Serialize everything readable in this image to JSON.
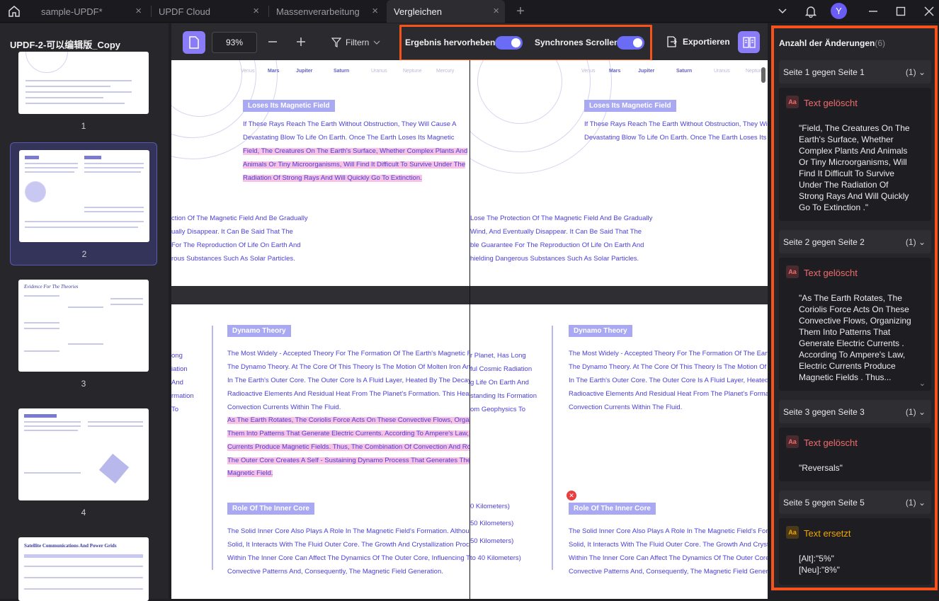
{
  "tabs": [
    {
      "label": "sample-UPDF*"
    },
    {
      "label": "UPDF Cloud"
    },
    {
      "label": "Massenverarbeitung"
    },
    {
      "label": "Vergleichen"
    }
  ],
  "window": {
    "avatar_letter": "Y",
    "close_glyph": "×",
    "add_tab_glyph": "+"
  },
  "sidebar": {
    "file_title": "UPDF-2-可以编辑版_Copy",
    "pages": [
      "1",
      "2",
      "3",
      "4"
    ],
    "thumb3_title": "Evidence For The Theories",
    "thumb5_title": "Satellite Communications And Power Grids"
  },
  "toolbar": {
    "zoom": "93%",
    "filter_label": "Filtern",
    "highlight_label": "Ergebnis hervorheben",
    "highlight_on": true,
    "sync_scroll_label": "Synchrones Scrollen",
    "sync_scroll_on": true,
    "export_label": "Exportieren"
  },
  "document": {
    "planets": [
      "Venus",
      "Mars",
      "Jupiter",
      "Saturn",
      "Uranus",
      "Neptune",
      "Mercury"
    ],
    "top": {
      "heading": "Loses Its Magnetic Field",
      "lines": [
        "If These Rays Reach The Earth Without Obstruction, They Will Cause A",
        "Devastating Blow To Life On Earth. Once The Earth Loses Its Magnetic",
        "Field, The Creatures On The Earth's Surface, Whether Complex Plants And",
        "Animals Or Tiny Microorganisms, Will Find It Difficult To Survive Under The",
        "Radiation Of Strong Rays And Will Quickly Go To Extinction."
      ],
      "left_lower": [
        "ction Of The Magnetic Field And Be Gradually",
        "ually Disappear. It Can Be Said That The",
        "For The Reproduction Of Life On Earth And",
        "rous Substances Such As Solar Particles."
      ],
      "right_lower": [
        "Lose The Protection Of The Magnetic Field And Be Gradually",
        "Wind, And Eventually Disappear. It Can Be Said That The",
        "ble Guarantee For The Reproduction Of Life On Earth And",
        "hielding Dangerous Substances Such As Solar Particles."
      ]
    },
    "bottom": {
      "dynamo_heading": "Dynamo Theory",
      "dynamo_lines": [
        "The Most Widely - Accepted Theory For The Formation Of The Earth's Magnetic Field Is",
        "The Dynamo Theory. At The Core Of This Theory Is The Motion Of Molten Iron And Nickel",
        "In The Earth's Outer Core. The Outer Core Is A Fluid Layer, Heated By The Decay Of",
        "Radioactive Elements And Residual Heat From The Planet's Formation. This Heat Creates",
        "Convection Currents Within The Fluid."
      ],
      "dynamo_highlight": [
        "As The Earth Rotates, The Coriolis Force Acts On These Convective Flows, Organizing",
        "Them Into Patterns That Generate Electric Currents. According To Ampere's Law, Electric",
        "Currents Produce Magnetic Fields. Thus, The Combination Of Convection And Rotation In",
        "The Outer Core Creates A Self - Sustaining Dynamo Process That Generates The Earth's",
        "Magnetic Field."
      ],
      "left_margin": [
        "ong",
        "iation",
        "And",
        "rmation",
        "To"
      ],
      "right_margin": [
        "r Planet, Has Long",
        "ful Cosmic Radiation",
        "g Life On Earth And",
        "standing Its Formation",
        "om Geophysics To"
      ],
      "km_lines": [
        "0 Kilometers)",
        "50 Kilometers)",
        "50 Kilometers)",
        "to 40 Kilometers)"
      ],
      "inner_heading": "Role Of The Inner Core",
      "inner_lines": [
        "The Solid Inner Core Also Plays A Role In The Magnetic Field's Formation. Although It Is",
        "Solid, It Interacts With The Fluid Outer Core. The Growth And Crystallization Processes",
        "Within The Inner Core Can Affect The Dynamics Of The Outer Core, Influencing The",
        "Convective Patterns And, Consequently, The Magnetic Field Generation."
      ]
    }
  },
  "changes": {
    "title": "Anzahl der Änderungen",
    "count": "(6)",
    "groups": [
      {
        "label": "Seite 1 gegen Seite 1",
        "count": "(1)",
        "type": "Text gelöscht",
        "type_color": "#f26b6b",
        "body": "\"Field, The Creatures On The Earth's Surface, Whether Complex Plants And Animals Or Tiny Microorganisms, Will Find It Difficult To Survive Under The Radiation Of Strong Rays And Will Quickly Go To Extinction .\""
      },
      {
        "label": "Seite 2 gegen Seite 2",
        "count": "(1)",
        "type": "Text gelöscht",
        "type_color": "#f26b6b",
        "body": "\"As The Earth Rotates, The Coriolis Force Acts On These Convective Flows, Organizing Them Into Patterns That Generate Electric Currents . According To Ampere's Law, Electric Currents Produce Magnetic Fields . Thus..."
      },
      {
        "label": "Seite 3 gegen Seite 3",
        "count": "(1)",
        "type": "Text gelöscht",
        "type_color": "#f26b6b",
        "body": "\"Reversals\""
      },
      {
        "label": "Seite 5 gegen Seite 5",
        "count": "(1)",
        "type": "Text ersetzt",
        "type_color": "#f0a500",
        "body": "[Alt]:\"5%\"\n[Neu]:\"8%\""
      }
    ]
  },
  "colors": {
    "accent": "#6a6cf6",
    "highlight_border": "#f5521c",
    "deleted": "#f26b6b",
    "replaced": "#f0a500"
  }
}
